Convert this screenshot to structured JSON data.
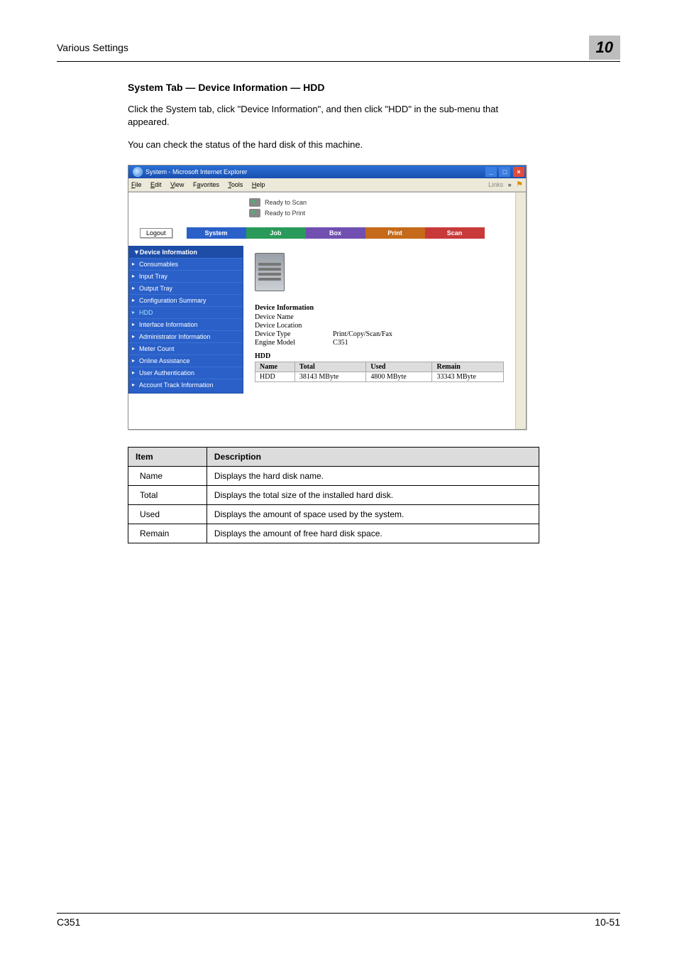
{
  "running_header": {
    "left": "Various Settings",
    "chapter": "10"
  },
  "section_title": "System Tab — Device Information — HDD",
  "para1": "Click the System tab, click \"Device Information\", and then click \"HDD\" in the sub-menu that appeared.",
  "para2": "You can check the status of the hard disk of this machine.",
  "screenshot": {
    "window_title": "System - Microsoft Internet Explorer",
    "menubar": {
      "items": [
        "File",
        "Edit",
        "View",
        "Favorites",
        "Tools",
        "Help"
      ],
      "links_label": "Links"
    },
    "status": {
      "scan": "Ready to Scan",
      "print": "Ready to Print"
    },
    "logout": "Logout",
    "tabs": {
      "system": "System",
      "job": "Job",
      "box": "Box",
      "print": "Print",
      "scan": "Scan"
    },
    "sidebar": {
      "header": "▼Device Information",
      "items": [
        "Consumables",
        "Input Tray",
        "Output Tray",
        "Configuration Summary",
        "HDD",
        "Interface Information",
        "Administrator Information",
        "Meter Count",
        "Online Assistance",
        "User Authentication",
        "Account Track Information"
      ],
      "selected_index": 4
    },
    "pane": {
      "heading1": "Device Information",
      "rows": [
        {
          "label": "Device Name",
          "value": ""
        },
        {
          "label": "Device Location",
          "value": ""
        },
        {
          "label": "Device Type",
          "value": "Print/Copy/Scan/Fax"
        },
        {
          "label": "Engine Model",
          "value": "C351"
        }
      ],
      "heading2": "HDD",
      "table": {
        "headers": [
          "Name",
          "Total",
          "Used",
          "Remain"
        ],
        "row": [
          "HDD",
          "38143 MByte",
          "4800 MByte",
          "33343 MByte"
        ]
      }
    }
  },
  "desc_table": {
    "headers": [
      "Item",
      "Description"
    ],
    "rows": [
      [
        "Name",
        "Displays the hard disk name."
      ],
      [
        "Total",
        "Displays the total size of the installed hard disk."
      ],
      [
        "Used",
        "Displays the amount of space used by the system."
      ],
      [
        "Remain",
        "Displays the amount of free hard disk space."
      ]
    ]
  },
  "footer": {
    "left": "C351",
    "right": "10-51"
  }
}
